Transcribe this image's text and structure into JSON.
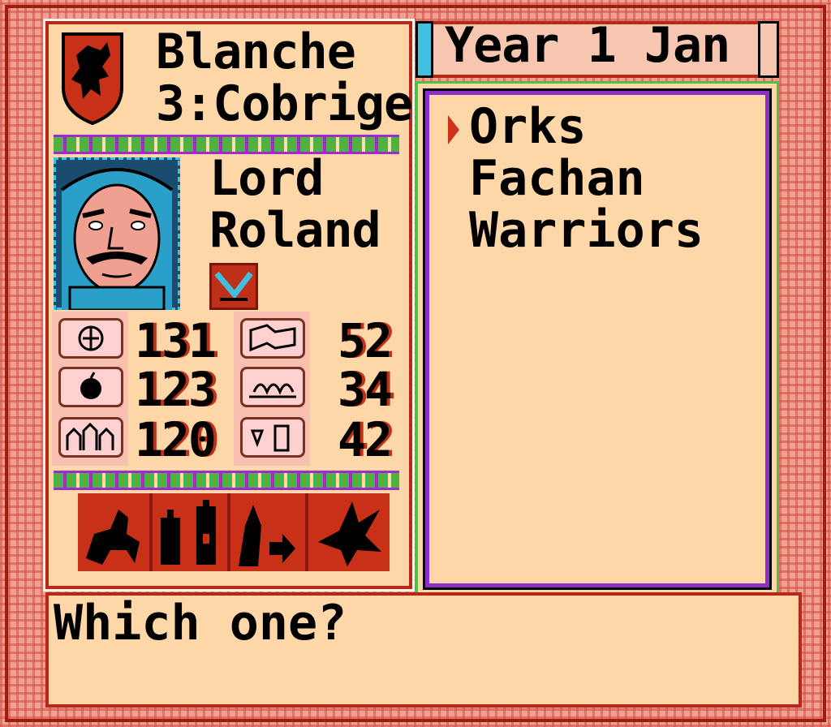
{
  "header": {
    "kingdom": "Blanche",
    "province": "3:Cobrige"
  },
  "lord": {
    "title": "Lord",
    "name": "Roland"
  },
  "stats": [
    {
      "icon": "gold-icon",
      "value": "131"
    },
    {
      "icon": "flag-icon",
      "value": "52"
    },
    {
      "icon": "food-icon",
      "value": "123"
    },
    {
      "icon": "crops-icon",
      "value": "34"
    },
    {
      "icon": "castle-icon",
      "value": "120"
    },
    {
      "icon": "people-icon",
      "value": "42"
    }
  ],
  "date": {
    "label": "Year 1  Jan"
  },
  "list": {
    "items": [
      "Orks",
      "Fachan",
      "Warriors"
    ]
  },
  "prompt": {
    "text": "Which one?"
  },
  "commands": [
    {
      "icon": "cavalry-icon"
    },
    {
      "icon": "army-castle-icon"
    },
    {
      "icon": "march-icon"
    },
    {
      "icon": "dragon-icon"
    }
  ],
  "colors": {
    "panel": "#fdd7a8",
    "border_red": "#b82818",
    "vine_green": "#50b040",
    "vine_purple": "#a02ad0",
    "command_red": "#c83018"
  }
}
